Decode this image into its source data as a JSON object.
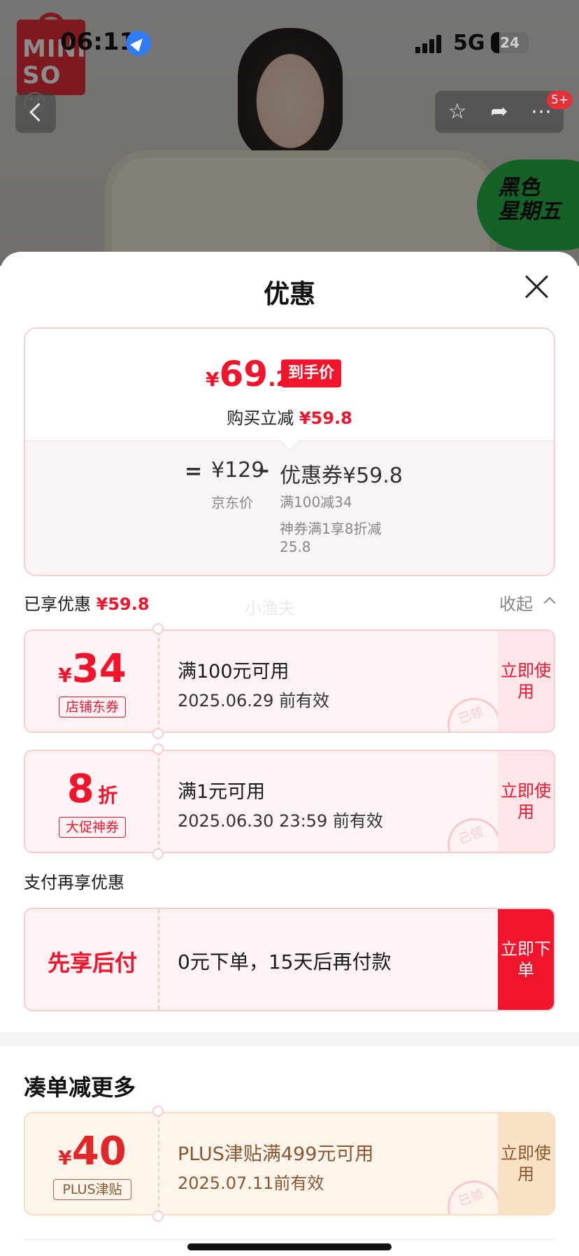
{
  "status_bar": {
    "time": "06:11",
    "network": "5G",
    "battery": "24"
  },
  "background": {
    "brand_line1": "MINI",
    "brand_line2": "SO☺",
    "promo_line1": "黑色",
    "promo_line2": "星期五",
    "notification_badge": "5+"
  },
  "sheet": {
    "title": "优惠",
    "price_summary": {
      "currency": "¥",
      "final_int": "69",
      "final_dec": ".2",
      "final_tag": "到手价",
      "reduce_label": "购买立减",
      "reduce_amount": "¥59.8",
      "eq": "=",
      "base_price": "¥129",
      "base_label": "京东价",
      "minus": "–",
      "coupon_total": "优惠券¥59.8",
      "coupon_detail_1": "满100减34",
      "coupon_detail_2": "神券满1享8折减",
      "coupon_detail_3": "25.8"
    },
    "enjoyed": {
      "label": "已享优惠",
      "amount": "¥59.8",
      "collapse": "收起",
      "watermark": "小渔夫"
    },
    "coupons": [
      {
        "currency": "¥",
        "amount": "34",
        "unit": "",
        "tag": "店铺东券",
        "condition": "满100元可用",
        "expire": "2025.06.29 前有效",
        "button": "立即使用",
        "stamp": "已领"
      },
      {
        "currency": "",
        "amount": "8",
        "unit": "折",
        "tag": "大促神券",
        "condition": "满1元可用",
        "expire": "2025.06.30 23:59 前有效",
        "button": "立即使用",
        "stamp": "已领"
      }
    ],
    "pay_section": {
      "label": "支付再享优惠",
      "title": "先享后付",
      "desc": "0元下单，15天后再付款",
      "button": "立即下单"
    },
    "more_section": {
      "title": "凑单减更多",
      "currency": "¥",
      "amount": "40",
      "tag": "PLUS津贴",
      "condition": "PLUS津贴满499元可用",
      "expire": "2025.07.11前有效",
      "button": "立即使用",
      "stamp": "已领"
    }
  },
  "colors": {
    "accent_red": "#f0142d",
    "coupon_bg": "#fdf3f4",
    "plus_bg": "#fdf5ec",
    "plus_text": "#8a5630"
  }
}
